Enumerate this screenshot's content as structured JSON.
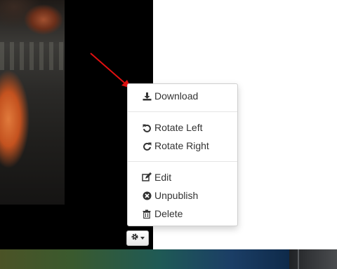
{
  "menu": {
    "items": [
      {
        "label": "Download",
        "icon": "download-icon"
      },
      {
        "label": "Rotate Left",
        "icon": "rotate-left-icon"
      },
      {
        "label": "Rotate Right",
        "icon": "rotate-right-icon"
      },
      {
        "label": "Edit",
        "icon": "edit-icon"
      },
      {
        "label": "Unpublish",
        "icon": "unpublish-icon"
      },
      {
        "label": "Delete",
        "icon": "trash-icon"
      }
    ]
  },
  "toolbar": {
    "settings_icon": "gear-icon"
  },
  "colors": {
    "arrow": "#e01010",
    "menu_text": "#333333",
    "viewer_bg": "#000000"
  }
}
